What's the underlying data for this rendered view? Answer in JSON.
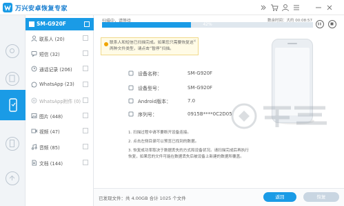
{
  "app": {
    "title": "万兴安卓恢复专家"
  },
  "window_controls": [
    "chevron-icon",
    "cart-icon",
    "user-icon",
    "menu-icon",
    "minimize-icon",
    "close-icon"
  ],
  "device": {
    "name": "SM-G920F"
  },
  "categories": [
    {
      "label": "联系人 (20)",
      "icon": "contacts-icon",
      "enabled": true
    },
    {
      "label": "短信 (32)",
      "icon": "message-icon",
      "enabled": true
    },
    {
      "label": "通话记录 (206)",
      "icon": "call-log-icon",
      "enabled": true
    },
    {
      "label": "WhatsApp (23)",
      "icon": "whatsapp-icon",
      "enabled": true
    },
    {
      "label": "WhatsApp附件 (0)",
      "icon": "whatsapp-attachment-icon",
      "enabled": false
    },
    {
      "label": "图片 (448)",
      "icon": "photo-icon",
      "enabled": true
    },
    {
      "label": "视频 (47)",
      "icon": "video-icon",
      "enabled": true
    },
    {
      "label": "音频 (85)",
      "icon": "audio-icon",
      "enabled": true
    },
    {
      "label": "文档 (144)",
      "icon": "document-icon",
      "enabled": true
    }
  ],
  "scan": {
    "label": "扫描中，请等待",
    "elapsed": "数余时间：大约 00:08:57",
    "progress_percent": 42,
    "progress_text": "42%"
  },
  "tooltip": {
    "text": "联系人和短信已扫描完成。如果您只需要恢复这两种文件类型，请点击“暂停”扫描。",
    "close": "×"
  },
  "device_info": [
    {
      "key": "设备名称：",
      "value": "SM-G920F"
    },
    {
      "key": "设备型号：",
      "value": "SM-G920F"
    },
    {
      "key": "Android版本：",
      "value": "7.0"
    },
    {
      "key": "序列号：",
      "value": "0915B****0C2D05"
    }
  ],
  "tips": [
    "1. 扫描过程中请不要断开设备连接。",
    "2. 点击左侧目录可以预览已找到的数据。",
    "3. 恢复成功率取决于数据丢失的方式和设备状况。请扫描完成后再执行恢复，如果您的文件可能在数据丢失后被设备上新建的数据所覆盖。"
  ],
  "footer": {
    "status": "已发现文件：共 4.00GB 合计 1025 个文件",
    "back_label": "返回",
    "recover_label": "恢复"
  },
  "colors": {
    "accent": "#1a9be6",
    "progress_track": "#dfe7ee",
    "disabled_button": "#c9d6e2"
  }
}
